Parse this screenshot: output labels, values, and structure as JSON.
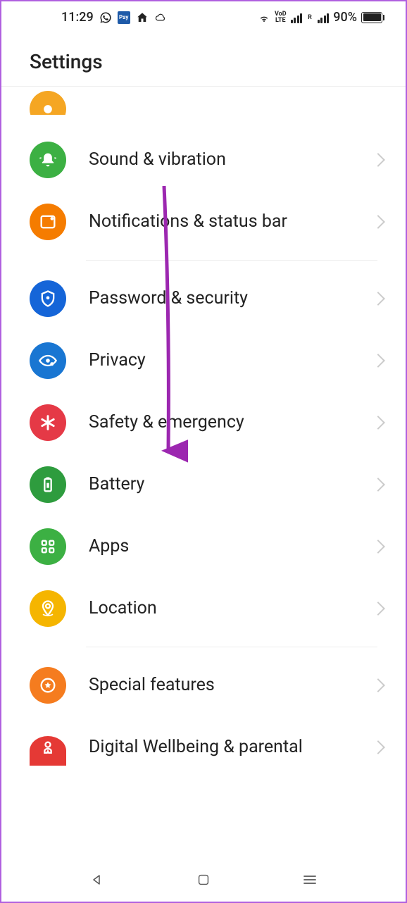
{
  "status_bar": {
    "time": "11:29",
    "battery_pct": "90%"
  },
  "header": {
    "title": "Settings"
  },
  "items": {
    "partial": {
      "label": ""
    },
    "sound": {
      "label": "Sound & vibration"
    },
    "notifications": {
      "label": "Notifications & status bar"
    },
    "password": {
      "label": "Password & security"
    },
    "privacy": {
      "label": "Privacy"
    },
    "safety": {
      "label": "Safety & emergency"
    },
    "battery": {
      "label": "Battery"
    },
    "apps": {
      "label": "Apps"
    },
    "location": {
      "label": "Location"
    },
    "special": {
      "label": "Special features"
    },
    "wellbeing": {
      "label": "Digital Wellbeing & parental"
    }
  }
}
